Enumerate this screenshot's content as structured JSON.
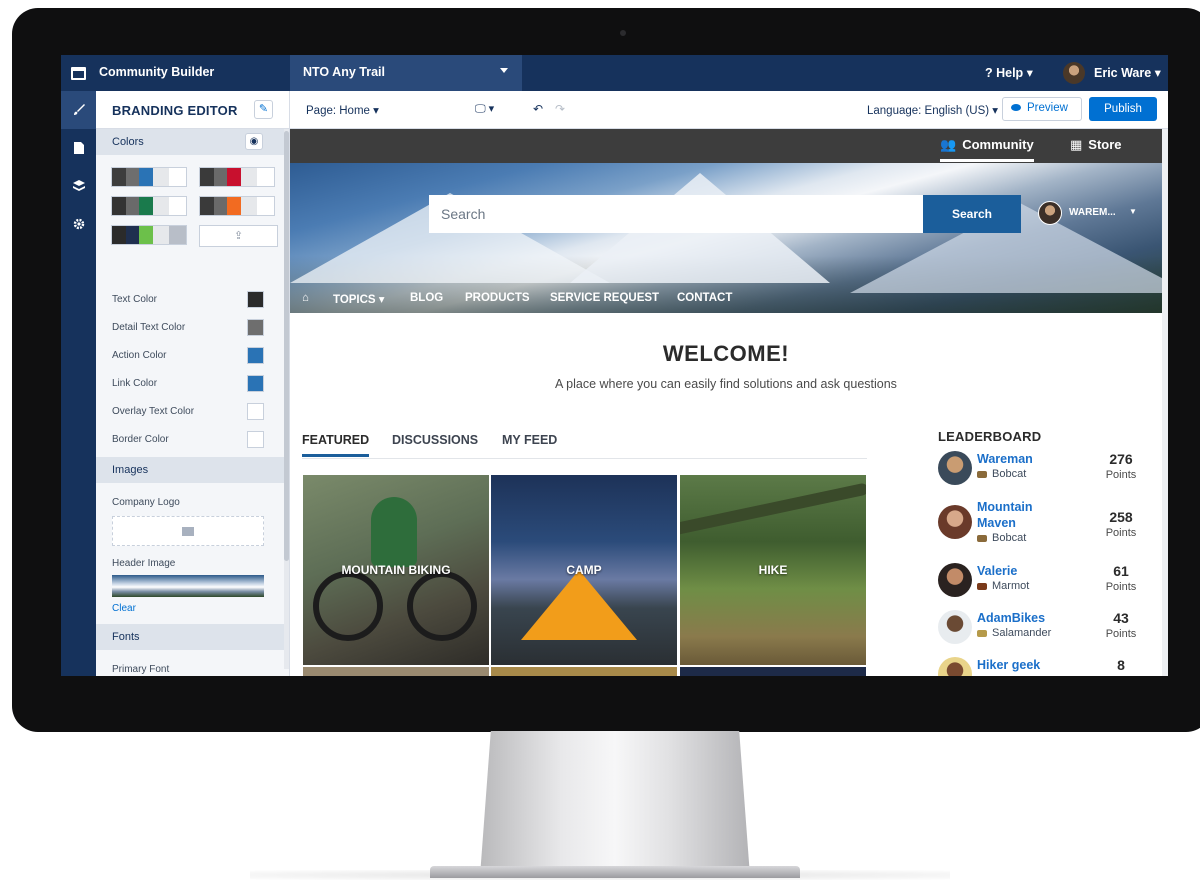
{
  "topbar": {
    "app_title": "Community Builder",
    "site_name": "NTO Any Trail",
    "help_label": "? Help ▾",
    "user_name": "Eric Ware ▾"
  },
  "rail": {
    "icons": [
      "paintbrush-icon",
      "page-icon",
      "layers-icon",
      "gear-icon"
    ]
  },
  "panel": {
    "title": "BRANDING EDITOR",
    "colors_section": "Colors",
    "palettes": [
      [
        "#3d3d3d",
        "#6e6e6e",
        "#2a73b5",
        "#e6e8eb",
        "#ffffff"
      ],
      [
        "#3a3a3a",
        "#6a6a6a",
        "#c8102e",
        "#e6e8eb",
        "#ffffff"
      ],
      [
        "#333333",
        "#6a6a6a",
        "#1a7a4c",
        "#e6e8eb",
        "#ffffff"
      ],
      [
        "#3a3a3a",
        "#6a6a6a",
        "#f26b21",
        "#e6e8eb",
        "#ffffff"
      ],
      [
        "#2b2b2b",
        "#1f2f4f",
        "#6cc04a",
        "#e6e8eb",
        "#b8bec8"
      ]
    ],
    "upload_label": "⇪",
    "color_rows": [
      {
        "label": "Text Color",
        "color": "#2b2b2b"
      },
      {
        "label": "Detail Text Color",
        "color": "#6e6e6e"
      },
      {
        "label": "Action Color",
        "color": "#2a73b5"
      },
      {
        "label": "Link Color",
        "color": "#2a73b5"
      },
      {
        "label": "Overlay Text Color",
        "color": "#ffffff"
      },
      {
        "label": "Border Color",
        "color": "#ffffff"
      }
    ],
    "images_section": "Images",
    "company_logo_label": "Company Logo",
    "header_image_label": "Header Image",
    "clear_label": "Clear",
    "fonts_section": "Fonts",
    "primary_font_label": "Primary Font"
  },
  "toolbar": {
    "page_label": "Page: Home ▾",
    "device_label": "🖵 ▾",
    "undo_label": "↶",
    "redo_label": "↷",
    "language_label": "Language: English (US) ▾",
    "preview_label": "Preview",
    "publish_label": "Publish"
  },
  "site": {
    "community_tab": "Community",
    "store_tab": "Store",
    "search_placeholder": "Search",
    "search_button": "Search",
    "user_short": "WAREM...",
    "nav": {
      "topics": "TOPICS ▾",
      "blog": "BLOG",
      "products": "PRODUCTS",
      "service_request": "SERVICE REQUEST",
      "contact": "CONTACT"
    },
    "welcome": "WELCOME!",
    "tagline": "A place where you can easily find solutions and ask questions",
    "tabs": {
      "featured": "FEATURED",
      "discussions": "DISCUSSIONS",
      "my_feed": "MY FEED"
    },
    "tiles": {
      "mountain_biking": "MOUNTAIN BIKING",
      "camp": "CAMP",
      "hike": "HIKE"
    },
    "leaderboard": {
      "title": "LEADERBOARD",
      "points_label": "Points",
      "rows": [
        {
          "name_line1": "Wareman",
          "name_line2": "",
          "rank": "Bobcat",
          "points": "276"
        },
        {
          "name_line1": "Mountain",
          "name_line2": "Maven",
          "rank": "Bobcat",
          "points": "258"
        },
        {
          "name_line1": "Valerie",
          "name_line2": "",
          "rank": "Marmot",
          "points": "61"
        },
        {
          "name_line1": "AdamBikes",
          "name_line2": "",
          "rank": "Salamander",
          "points": "43"
        },
        {
          "name_line1": "Hiker geek",
          "name_line2": "",
          "rank": "",
          "points": "8"
        }
      ]
    }
  }
}
